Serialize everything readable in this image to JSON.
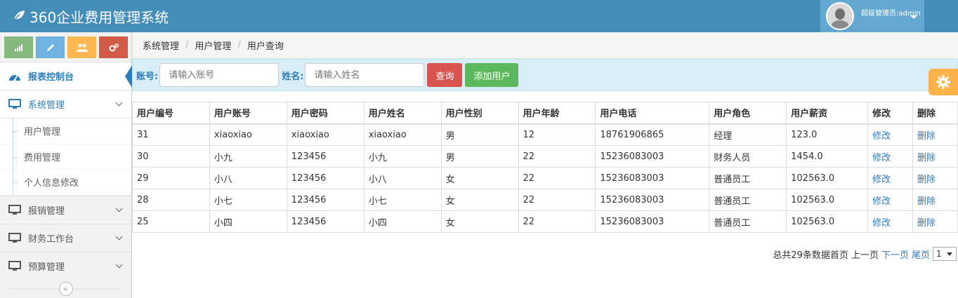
{
  "app": {
    "title": "360企业费用管理系统",
    "user_label": "超级管理员:admin"
  },
  "shortcuts": [
    {
      "icon": "signal-icon",
      "color": "#87b87f"
    },
    {
      "icon": "pencil-icon",
      "color": "#6fb3e0"
    },
    {
      "icon": "users-icon",
      "color": "#ffb752"
    },
    {
      "icon": "cogs-icon",
      "color": "#d15b47"
    }
  ],
  "sidebar": {
    "dashboard": "报表控制台",
    "system": "系统管理",
    "system_items": [
      "用户管理",
      "费用管理",
      "个人信息修改"
    ],
    "reimburse": "报销管理",
    "finance": "财务工作台",
    "budget": "预算管理"
  },
  "breadcrumb": [
    "系统管理",
    "用户管理",
    "用户查询"
  ],
  "search": {
    "account_label": "账号:",
    "account_placeholder": "请输入账号",
    "name_label": "姓名:",
    "name_placeholder": "请输入姓名",
    "query_button": "查询",
    "add_button": "添加用户"
  },
  "table": {
    "headers": [
      "用户编号",
      "用户账号",
      "用户密码",
      "用户姓名",
      "用户性别",
      "用户年龄",
      "用户电话",
      "用户角色",
      "用户薪资",
      "修改",
      "删除"
    ],
    "rows": [
      [
        "31",
        "xiaoxiao",
        "xiaoxiao",
        "xiaoxiao",
        "男",
        "12",
        "18761906865",
        "经理",
        "123.0",
        "修改",
        "删除"
      ],
      [
        "30",
        "小九",
        "123456",
        "小九",
        "男",
        "22",
        "15236083003",
        "财务人员",
        "1454.0",
        "修改",
        "删除"
      ],
      [
        "29",
        "小八",
        "123456",
        "小八",
        "女",
        "22",
        "15236083003",
        "普通员工",
        "102563.0",
        "修改",
        "删除"
      ],
      [
        "28",
        "小七",
        "123456",
        "小七",
        "女",
        "22",
        "15236083003",
        "普通员工",
        "102563.0",
        "修改",
        "删除"
      ],
      [
        "25",
        "小四",
        "123456",
        "小四",
        "女",
        "22",
        "15236083003",
        "普通员工",
        "102563.0",
        "修改",
        "删除"
      ]
    ]
  },
  "pager": {
    "summary": "总共29条数据首页",
    "prev": "上一页",
    "next": "下一页",
    "last": "尾页",
    "page": "1"
  },
  "colors": {
    "navbar": "#438eb9",
    "accent": "#2b7dbc",
    "link": "#337ab7",
    "danger": "#d9534f",
    "success": "#5cb85c"
  }
}
